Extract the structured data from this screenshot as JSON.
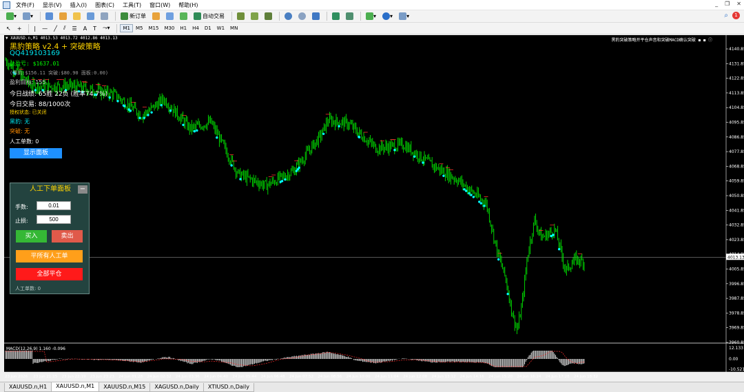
{
  "menu": [
    "文件(F)",
    "显示(V)",
    "插入(I)",
    "图表(C)",
    "工具(T)",
    "窗口(W)",
    "帮助(H)"
  ],
  "toolbar": {
    "new_order": "新订单",
    "auto_trade": "自动交易",
    "timeframes": [
      "M1",
      "M5",
      "M15",
      "M30",
      "H1",
      "H4",
      "D1",
      "W1",
      "MN"
    ],
    "active_timeframe": "M1"
  },
  "chart": {
    "header": "▼ XAUUSD.n,M1  4013.53 4013.72 4012.86 4013.13",
    "top_right_note": "黑豹突破策略开平仓声音和突破MACD确认突破 ◼ ◼ ⓘ",
    "price_labels": [
      "4140.85",
      "4131.85",
      "4122.85",
      "4113.85",
      "4104.85",
      "4095.85",
      "4086.85",
      "4077.85",
      "4068.85",
      "4059.85",
      "4050.85",
      "4041.85",
      "4032.85",
      "4023.85",
      "4014.85",
      "4005.85",
      "3996.85",
      "3987.85",
      "3978.85",
      "3969.85",
      "3960.85"
    ],
    "current_price": "4013.13",
    "time_labels": [
      "23 Jun 2026",
      "23 Jun 21:15",
      "23 Jun 22:19",
      "23 Jun 23:23",
      "24 Jun 01:28",
      "24 Jun 02:32",
      "24 Jun 03:36",
      "24 Jun 04:40",
      "24 Jun 05:44",
      "24 Jun 06:48",
      "24 Jun 07:52",
      "24 Jun 08:56",
      "24 Jun 10:00",
      "24 Jun 11:04",
      "24 Jun 12:08",
      "24 Jun 13:12",
      "24 Jun 14:16",
      "24 Jun 15:20",
      "24 Jun 16:24",
      "24 Jun 17:28",
      "24 Jun 18:32"
    ],
    "macd_label": "MACD(12,26,9) 1.160 -0.096",
    "macd_scale": [
      "12.133",
      "0.00",
      "-10.521"
    ]
  },
  "overlay": {
    "strategy_title": "黑豹策略 v2.4 + 突破策略",
    "qq": "QQ419103169",
    "pnl": "总盈亏: $1637.01",
    "sub_stats": "(黑豹:$156.11 突破:$80.90 面板:0.00)",
    "profit_target": "盈利目标: 155",
    "today_record": "今日战绩: 65胜 22负 (胜率74.7%)",
    "today_trades": "今日交易: 88/1000次",
    "auth_status": "授权状态: 已关闭",
    "heibao": "黑豹: 无",
    "breakout": "突破: 无",
    "manual_count": "人工单数: 0",
    "show_panel": "显示面板"
  },
  "panel": {
    "title": "人工下单面板",
    "minimize": "−",
    "lots_label": "手数:",
    "lots_value": "0.01",
    "sl_label": "止损:",
    "sl_value": "500",
    "buy": "买入",
    "sell": "卖出",
    "close_manual": "平所有人工单",
    "close_all": "全部平仓",
    "manual_count": "人工单数: 0"
  },
  "tabs": [
    "XAUUSD.n,H1",
    "XAUUSD.n,M1",
    "XAUUSD.n,M15",
    "XAGUSD.n,Daily",
    "XTIUSD.n,Daily"
  ],
  "active_tab": 1,
  "colors": {
    "candle": "#00e600",
    "buy_marker": "#00ffff",
    "sell_marker": "#ff3030",
    "accent_yellow": "#ffd400",
    "pnl_green": "#00ff00"
  }
}
